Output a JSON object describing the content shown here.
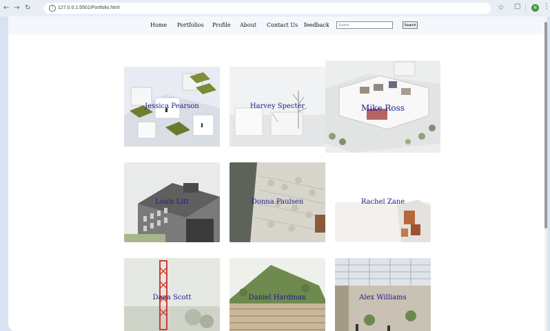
{
  "browser": {
    "url": "127.0.0.1:5501/Portfolio.html",
    "avatar_letter": "N"
  },
  "nav": {
    "links": [
      "Home",
      "Portfolios",
      "Profile",
      "About",
      "Contact Us",
      "feedback"
    ],
    "search_placeholder": "Search",
    "search_button": "Search"
  },
  "portfolios": [
    {
      "name": "Jessica Pearson"
    },
    {
      "name": "Harvey Specter"
    },
    {
      "name": "Mike Ross"
    },
    {
      "name": "Louis Litt"
    },
    {
      "name": "Donna Paulsen"
    },
    {
      "name": "Rachel Zane"
    },
    {
      "name": "Dana Scott"
    },
    {
      "name": "Daniel Hardman"
    },
    {
      "name": "Alex Williams"
    }
  ]
}
